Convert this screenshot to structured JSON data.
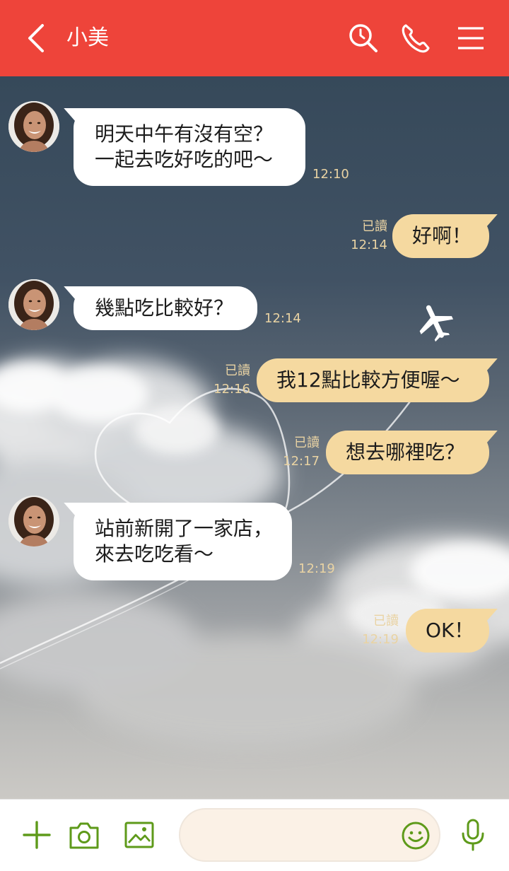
{
  "header": {
    "title": "小美",
    "back_icon": "chevron-left-icon",
    "icons": [
      "search-icon",
      "phone-icon",
      "menu-icon"
    ],
    "color": "#ee443a"
  },
  "messages": [
    {
      "side": "in",
      "lines": [
        "明天中午有沒有空？",
        "一起去吃好吃的吧～"
      ],
      "time": "12:10"
    },
    {
      "side": "out",
      "lines": [
        "好啊！"
      ],
      "read": "已讀",
      "time": "12:14"
    },
    {
      "side": "in",
      "lines": [
        "幾點吃比較好？"
      ],
      "time": "12:14"
    },
    {
      "side": "out",
      "lines": [
        "我12點比較方便喔～"
      ],
      "read": "已讀",
      "time": "12:16"
    },
    {
      "side": "out",
      "lines": [
        "想去哪裡吃？"
      ],
      "read": "已讀",
      "time": "12:17"
    },
    {
      "side": "in",
      "lines": [
        "站前新開了一家店，",
        "來去吃吃看～"
      ],
      "time": "12:19"
    },
    {
      "side": "out",
      "lines": [
        "OK！"
      ],
      "read": "已讀",
      "time": "12:19"
    }
  ],
  "composer": {
    "placeholder": "",
    "icons": [
      "plus-icon",
      "camera-icon",
      "image-icon",
      "smiley-icon",
      "microphone-icon"
    ],
    "accent": "#5e9a1a"
  },
  "colors": {
    "bubble_out": "#f5d9a0",
    "bubble_in": "#ffffff",
    "meta_text": "#e9d3a3"
  }
}
